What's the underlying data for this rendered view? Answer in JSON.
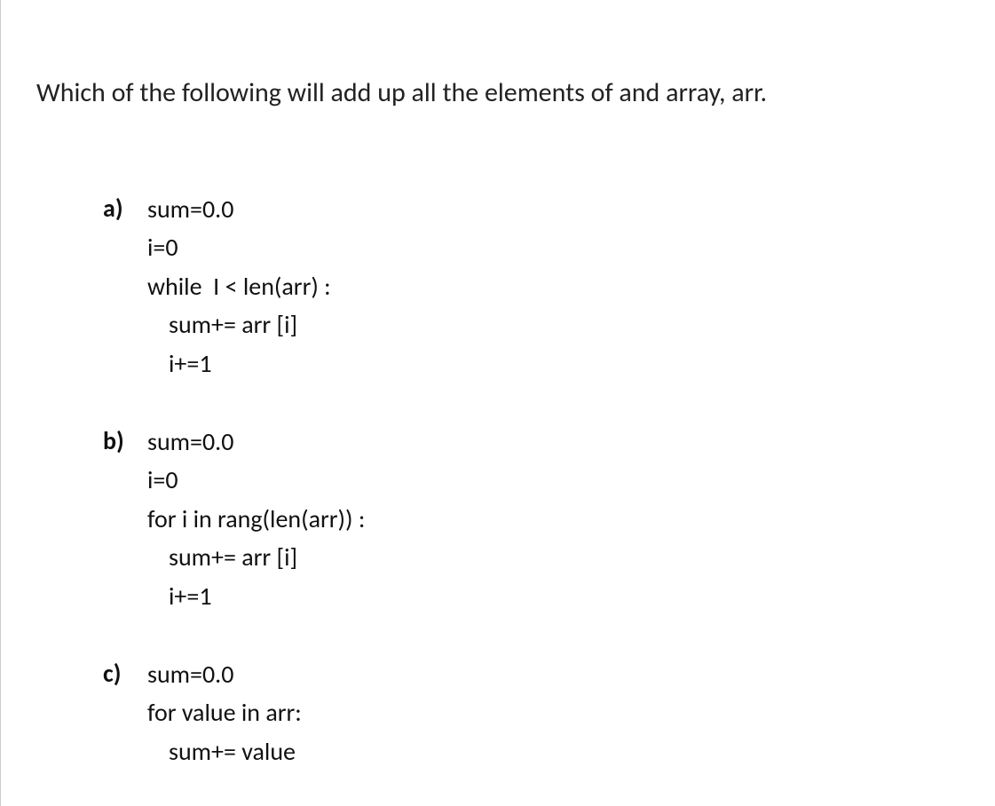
{
  "question": "Which of the following will add up all the elements of and array, arr.",
  "options": {
    "a": {
      "label": "a)",
      "lines": [
        "sum=0.0",
        "i=0",
        "while  I < len(arr) :",
        "  sum+= arr [i]",
        "  i+=1"
      ]
    },
    "b": {
      "label": "b)",
      "lines": [
        "sum=0.0",
        "i=0",
        "for i in rang(len(arr)) :",
        "  sum+= arr [i]",
        "  i+=1"
      ]
    },
    "c": {
      "label": "c)",
      "lines": [
        "sum=0.0",
        "for value in arr:",
        "  sum+= value"
      ]
    }
  }
}
